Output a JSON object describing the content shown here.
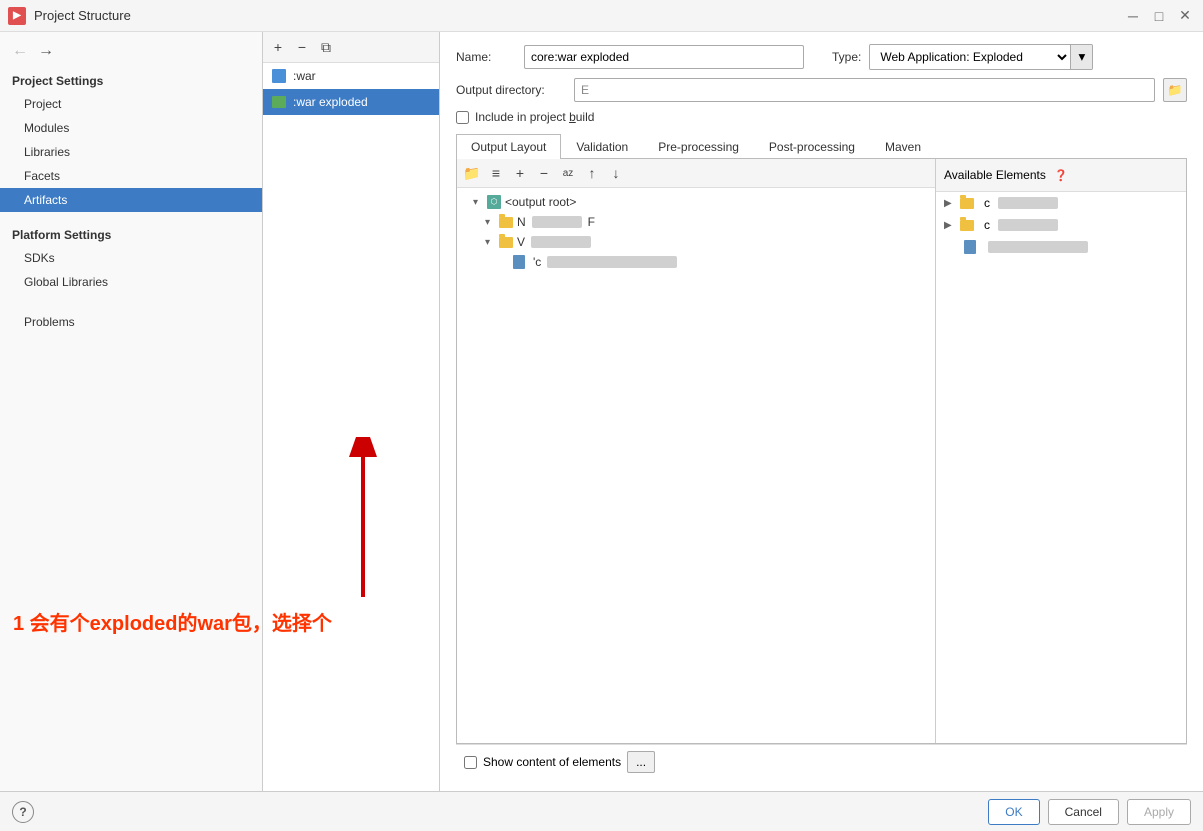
{
  "window": {
    "title": "Project Structure",
    "close_btn": "✕",
    "min_btn": "─",
    "max_btn": "□"
  },
  "nav": {
    "back_btn": "←",
    "forward_btn": "→"
  },
  "sidebar": {
    "project_settings_header": "Project Settings",
    "items": [
      {
        "label": "Project",
        "id": "project"
      },
      {
        "label": "Modules",
        "id": "modules"
      },
      {
        "label": "Libraries",
        "id": "libraries"
      },
      {
        "label": "Facets",
        "id": "facets"
      },
      {
        "label": "Artifacts",
        "id": "artifacts",
        "active": true
      }
    ],
    "platform_settings_header": "Platform Settings",
    "platform_items": [
      {
        "label": "SDKs",
        "id": "sdks"
      },
      {
        "label": "Global Libraries",
        "id": "global-libraries"
      }
    ],
    "problems_label": "Problems"
  },
  "artifact_panel": {
    "toolbar": {
      "add_btn": "+",
      "remove_btn": "−",
      "copy_btn": "⧉"
    },
    "items": [
      {
        "label": ":war",
        "id": "war"
      },
      {
        "label": ":war exploded",
        "id": "war-exploded",
        "selected": true
      }
    ]
  },
  "main": {
    "name_label": "Name:",
    "name_value": "core:war exploded",
    "type_label": "Type:",
    "type_value": "Web Application: Exploded",
    "output_dir_label": "Output directory:",
    "output_dir_value": "E",
    "include_label": "Include in project build",
    "tabs": [
      {
        "label": "Output Layout",
        "active": true
      },
      {
        "label": "Validation"
      },
      {
        "label": "Pre-processing"
      },
      {
        "label": "Post-processing"
      },
      {
        "label": "Maven"
      }
    ],
    "tree_toolbar": {
      "btns": [
        "📁",
        "≡",
        "+",
        "−",
        "az",
        "↑",
        "↓"
      ]
    },
    "tree_items": [
      {
        "label": "<output root>",
        "indent": 0,
        "expand": true,
        "icon": "output-root"
      },
      {
        "label": "N",
        "blur": "XXXXXXF",
        "indent": 1,
        "expand": true,
        "icon": "folder"
      },
      {
        "label": "V",
        "blur": "XXXXXXXX",
        "indent": 1,
        "expand": true,
        "icon": "folder"
      },
      {
        "label": "'c",
        "blur": "XXXXXXXXXXXXXXXXXXXXXX",
        "indent": 2,
        "expand": false,
        "icon": "file"
      }
    ],
    "available_elements_label": "Available Elements",
    "available_items": [
      {
        "label": "c",
        "blur": "XXXXXXXX",
        "expand": true,
        "icon": "folder"
      },
      {
        "label": "c",
        "blur": "XXXXXXXX",
        "expand": true,
        "icon": "folder"
      },
      {
        "label": "",
        "blur": "XXXXXXXXXXXXXXX",
        "expand": false,
        "icon": "file"
      }
    ],
    "show_content_label": "Show content of elements",
    "show_content_btn": "..."
  },
  "annotation": {
    "text": "1 会有个exploded的war包，选择个"
  },
  "bottom": {
    "ok_label": "OK",
    "cancel_label": "Cancel",
    "apply_label": "Apply"
  }
}
